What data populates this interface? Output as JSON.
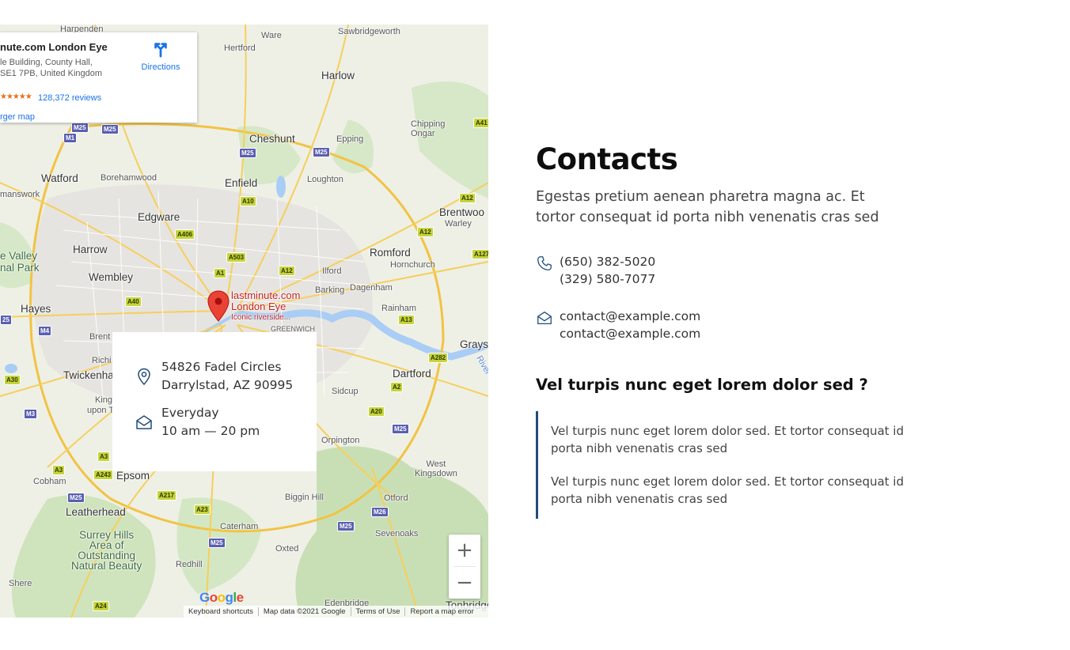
{
  "map": {
    "info_card": {
      "title": "nute.com London Eye",
      "address_line1": "le Building, County Hall,",
      "address_line2": "SE1 7PB, United Kingdom",
      "reviews": "128,372 reviews",
      "directions": "Directions",
      "larger_map": "rger map"
    },
    "pin": {
      "name_line1": "lastminute.com",
      "name_line2": "London Eye",
      "subtitle": "Iconic riverside..."
    },
    "places": {
      "harpenden": "Harpenden",
      "ware": "Ware",
      "sawbridgeworth": "Sawbridgeworth",
      "hertford": "Hertford",
      "harlow": "Harlow",
      "cheshunt": "Cheshunt",
      "epping": "Epping",
      "chipping_ongar": "Chipping\nOngar",
      "watford": "Watford",
      "borehamwood": "Borehamwood",
      "enfield": "Enfield",
      "loughton": "Loughton",
      "rickmansworth": "manswork",
      "edgware": "Edgware",
      "brentwood": "Brentwoo",
      "warley": "Warley",
      "harrow": "Harrow",
      "romford": "Romford",
      "colne_valley": "e Valley",
      "regional_park": "nal Park",
      "wembley": "Wembley",
      "ilford": "Ilford",
      "hornchurch": "Hornchurch",
      "barking": "Barking",
      "dagenham": "Dagenham",
      "hayes": "Hayes",
      "rainham": "Rainham",
      "greenwich": "GREENWICH",
      "brent": "Brent",
      "richmond": "Richi",
      "grays": "Grays",
      "twickenham": "Twickenha",
      "dartford": "Dartford",
      "kingston": "King",
      "upon_t": "upon T",
      "sidcup": "Sidcup",
      "orpington": "Orpington",
      "west_kingsdown": "West\nKingsdown",
      "cobham": "Cobham",
      "epsom": "Epsom",
      "biggin_hill": "Biggin Hill",
      "otford": "Otford",
      "leatherhead": "Leatherhead",
      "caterham": "Caterham",
      "sevenoaks": "Sevenoaks",
      "surrey_hills": "Surrey Hills\nArea of\nOutstanding\nNatural Beauty",
      "oxted": "Oxted",
      "redhill": "Redhill",
      "shere": "Shere",
      "edenbridge": "Edenbridge",
      "tonbridge": "Tonbridge",
      "river": "River"
    },
    "roads": {
      "m25": "M25",
      "m1": "M1",
      "m4": "M4",
      "m3": "M3",
      "m26": "M26",
      "a10": "A10",
      "a406": "A406",
      "a503": "A503",
      "a1": "A1",
      "a12": "A12",
      "a13": "A13",
      "a127": "A127",
      "a414": "A41",
      "a40": "A40",
      "a30": "A30",
      "a282": "A282",
      "a2": "A2",
      "a20": "A20",
      "a3": "A3",
      "a243": "A243",
      "a217": "A217",
      "a23": "A23",
      "a24": "A24",
      "a25": "25"
    },
    "address": {
      "line1": "54826 Fadel Circles",
      "line2": "Darrylstad, AZ 90995"
    },
    "hours": {
      "line1": "Everyday",
      "line2": "10 am — 20 pm"
    },
    "zoom_in": "+",
    "zoom_out": "−",
    "google": "Google",
    "footer": {
      "shortcuts": "Keyboard shortcuts",
      "data": "Map data ©2021 Google",
      "terms": "Terms of Use",
      "report": "Report a map error"
    }
  },
  "contacts": {
    "title": "Contacts",
    "intro": "Egestas pretium aenean pharetra magna ac. Et tortor consequat id porta nibh venenatis cras sed",
    "phones": [
      "(650) 382-5020",
      "(329) 580-7077"
    ],
    "emails": [
      "contact@example.com",
      "contact@example.com"
    ],
    "faq_title": "Vel turpis nunc eget lorem dolor sed ?",
    "faq_paragraphs": [
      "Vel turpis nunc eget lorem dolor sed. Et tortor consequat id porta nibh venenatis cras sed",
      "Vel turpis nunc eget lorem dolor sed. Et tortor consequat id porta nibh venenatis cras sed"
    ]
  },
  "colors": {
    "accent_border": "#1f4e79",
    "icon_stroke": "#1f4e79",
    "pin_red": "#ea4335",
    "link_blue": "#1a73e8"
  }
}
